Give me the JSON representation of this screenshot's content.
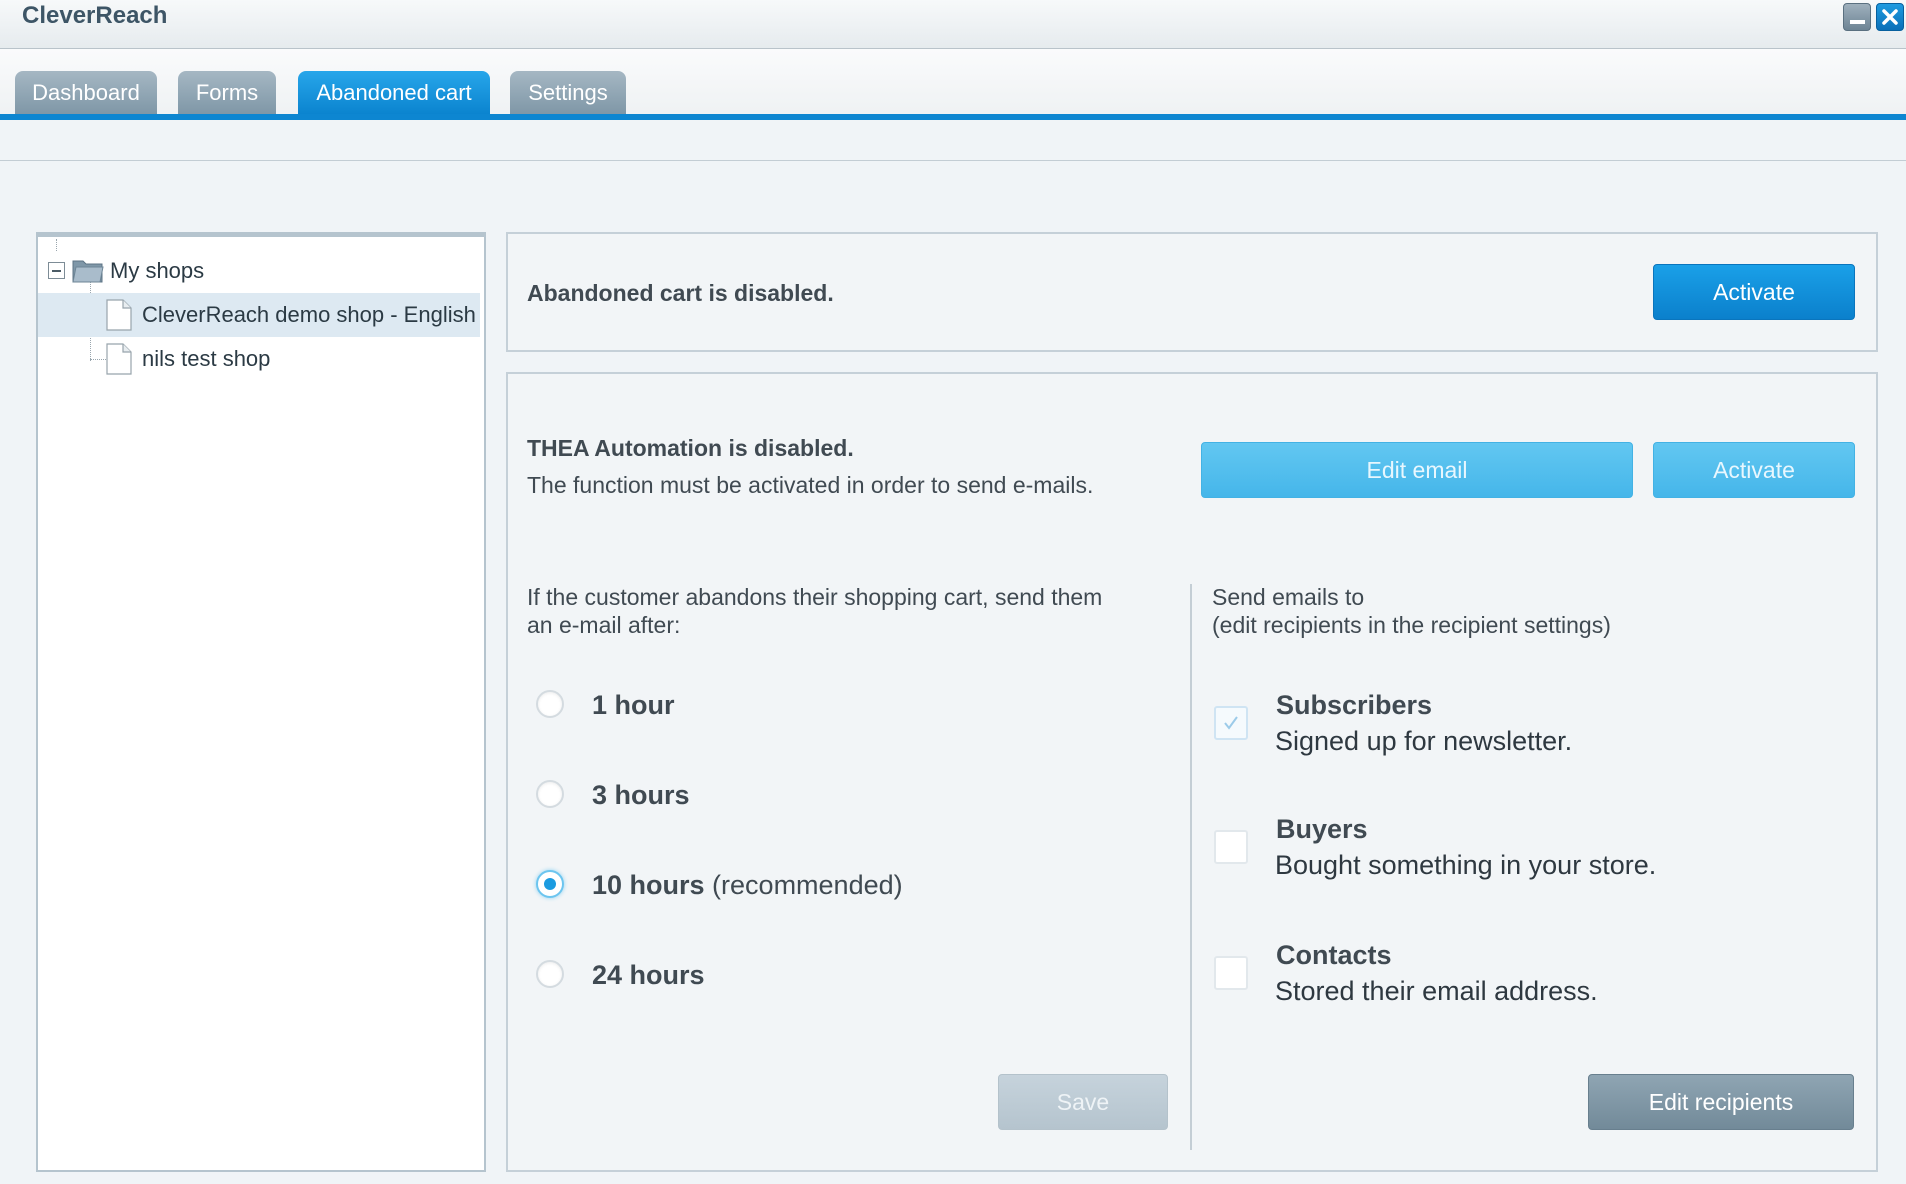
{
  "app": {
    "title": "CleverReach"
  },
  "tabs": [
    {
      "label": "Dashboard",
      "active": false
    },
    {
      "label": "Forms",
      "active": false
    },
    {
      "label": "Abandoned cart",
      "active": true
    },
    {
      "label": "Settings",
      "active": false
    }
  ],
  "tree": {
    "root_label": "My shops",
    "items": [
      {
        "label": "CleverReach demo shop - English",
        "selected": true
      },
      {
        "label": "nils test shop",
        "selected": false
      }
    ]
  },
  "abandoned_cart": {
    "status_text": "Abandoned cart is disabled.",
    "activate_label": "Activate"
  },
  "thea": {
    "status_text": "THEA Automation is disabled.",
    "status_note": "The function must be activated in order to send e-mails.",
    "edit_email_label": "Edit email",
    "activate_label": "Activate"
  },
  "timing": {
    "prompt_line1": "If the customer abandons their shopping cart, send them",
    "prompt_line2": "an e-mail after:",
    "options": [
      {
        "label": "1 hour",
        "suffix": "",
        "checked": false
      },
      {
        "label": "3 hours",
        "suffix": "",
        "checked": false
      },
      {
        "label": "10 hours",
        "suffix": " (recommended)",
        "checked": true
      },
      {
        "label": "24 hours",
        "suffix": "",
        "checked": false
      }
    ],
    "save_label": "Save"
  },
  "recipients": {
    "heading_line1": "Send emails to",
    "heading_line2": "(edit recipients in the recipient settings)",
    "groups": [
      {
        "title": "Subscribers",
        "description": "Signed up for newsletter.",
        "checked": true
      },
      {
        "title": "Buyers",
        "description": "Bought something in your store.",
        "checked": false
      },
      {
        "title": "Contacts",
        "description": "Stored their email address.",
        "checked": false
      }
    ],
    "edit_label": "Edit recipients"
  }
}
